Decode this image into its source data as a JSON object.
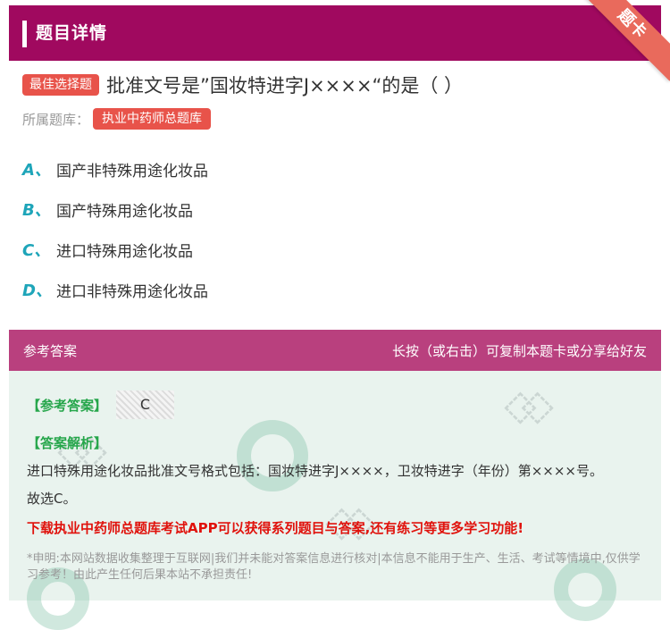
{
  "header": {
    "title": "题目详情",
    "ribbon": "题卡"
  },
  "question": {
    "badge": "最佳选择题",
    "text": "批准文号是”国妆特进字J××××“的是（ ）",
    "bank_label": "所属题库：",
    "bank": "执业中药师总题库"
  },
  "options": [
    {
      "letter": "A、",
      "text": "国产非特殊用途化妆品"
    },
    {
      "letter": "B、",
      "text": "国产特殊用途化妆品"
    },
    {
      "letter": "C、",
      "text": "进口特殊用途化妆品"
    },
    {
      "letter": "D、",
      "text": "进口非特殊用途化妆品"
    }
  ],
  "answer_bar": {
    "left": "参考答案",
    "right": "长按（或右击）可复制本题卡或分享给好友"
  },
  "answer": {
    "ref_label": "【参考答案】",
    "ref_value": "C",
    "analysis_label": "【答案解析】",
    "analysis_line1": "进口特殊用途化妆品批准文号格式包括：国妆特进字J××××，卫妆特进字（年份）第××××号。",
    "analysis_line2": "故选C。",
    "promo": "下载执业中药师总题库考试APP可以获得系列题目与答案,还有练习等更多学习功能!",
    "note": "*申明:本网站数据收集整理于互联网|我们并未能对答案信息进行核对|本信息不能用于生产、生活、考试等情境中,仅供学习参考！由此产生任何后果本站不承担责任!"
  },
  "colors": {
    "header": "#a0095f",
    "badge": "#e8534a",
    "option_letter": "#1ea5b9",
    "answer_bar": "#b9407e",
    "answer_panel": "#e9f3ee",
    "green": "#26a64b",
    "promo": "#e0120c"
  }
}
